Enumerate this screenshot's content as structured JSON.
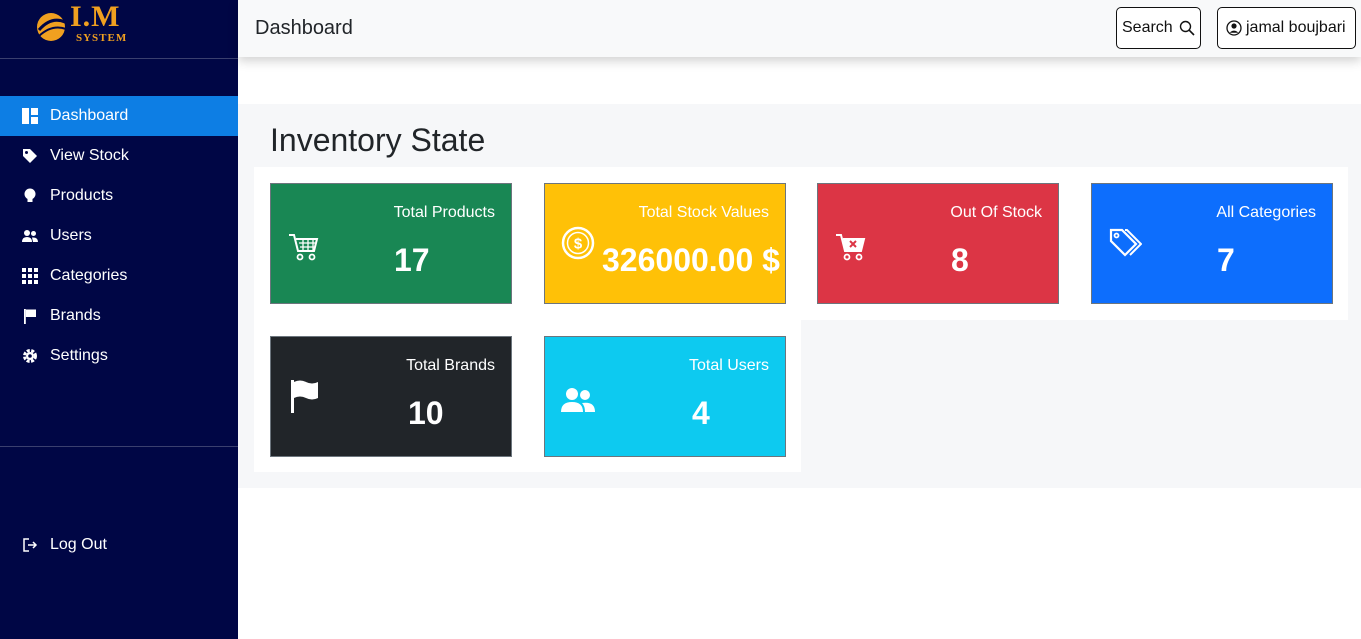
{
  "brand": {
    "logo_text": "I.M",
    "logo_sub": "SYSTEM",
    "accent": "#f0a020"
  },
  "sidebar": {
    "items": [
      {
        "label": "Dashboard",
        "icon": "dashboard-icon",
        "active": true
      },
      {
        "label": "View Stock",
        "icon": "tag-icon"
      },
      {
        "label": "Products",
        "icon": "lightbulb-icon"
      },
      {
        "label": "Users",
        "icon": "users-icon"
      },
      {
        "label": "Categories",
        "icon": "grid-icon"
      },
      {
        "label": "Brands",
        "icon": "flag-icon"
      },
      {
        "label": "Settings",
        "icon": "gear-icon"
      }
    ],
    "logout": {
      "label": "Log Out",
      "icon": "logout-icon"
    }
  },
  "header": {
    "title": "Dashboard",
    "search_label": "Search",
    "user_name": "jamal boujbari"
  },
  "main": {
    "title": "Inventory State",
    "cards": [
      {
        "label": "Total Products",
        "value": "17",
        "color": "#198754",
        "icon": "cart-icon"
      },
      {
        "label": "Total Stock Values",
        "value": "326000.00 $",
        "color": "#ffc107",
        "icon": "dollar-coin-icon"
      },
      {
        "label": "Out Of Stock",
        "value": "8",
        "color": "#dc3545",
        "icon": "cart-x-icon"
      },
      {
        "label": "All Categories",
        "value": "7",
        "color": "#0d6efd",
        "icon": "tags-icon"
      },
      {
        "label": "Total Brands",
        "value": "10",
        "color": "#212529",
        "icon": "flag-icon"
      },
      {
        "label": "Total Users",
        "value": "4",
        "color": "#0dcaf0",
        "icon": "users-icon"
      }
    ]
  }
}
